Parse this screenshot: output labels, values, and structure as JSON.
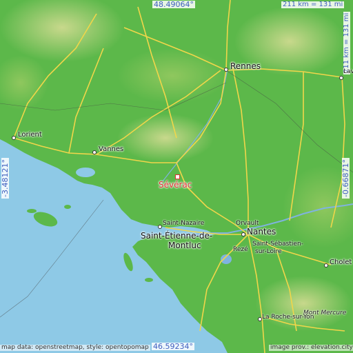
{
  "map": {
    "target_city": "Sévérac",
    "coordinates": {
      "north": "48.49064°",
      "south": "46.59234°",
      "west": "-3.48121°",
      "east": "-0.66871°"
    },
    "scale": {
      "horizontal": "211 km = 131 mi",
      "vertical": "211 km = 131 mi"
    },
    "credits": {
      "left": "map data: openstreetmap, style: opentopomap",
      "right": "image prov.: elevation.city"
    },
    "cities": {
      "rennes": "Rennes",
      "laval": "Laval",
      "lorient": "Lorient",
      "vannes": "Vannes",
      "saint_nazaire": "Saint-Nazaire",
      "saint_etienne": "Saint-Étienne-de-",
      "montluc": "Montluc",
      "orvault": "Orvault",
      "nantes": "Nantes",
      "reze": "Rezé",
      "saint_sebastien_1": "Saint-Sébastien-",
      "saint_sebastien_2": "sur-Loire",
      "cholet": "Cholet",
      "mont_mercure": "Mont Mercure",
      "la_roche": "La Roche-sur-Yon"
    },
    "colors": {
      "sea": "#8ec9e6",
      "land": "#5cb84a",
      "highland": "#c8d88a",
      "road": "#f1d64a",
      "target": "#e03030",
      "coord_text": "#3f5fbf"
    }
  }
}
